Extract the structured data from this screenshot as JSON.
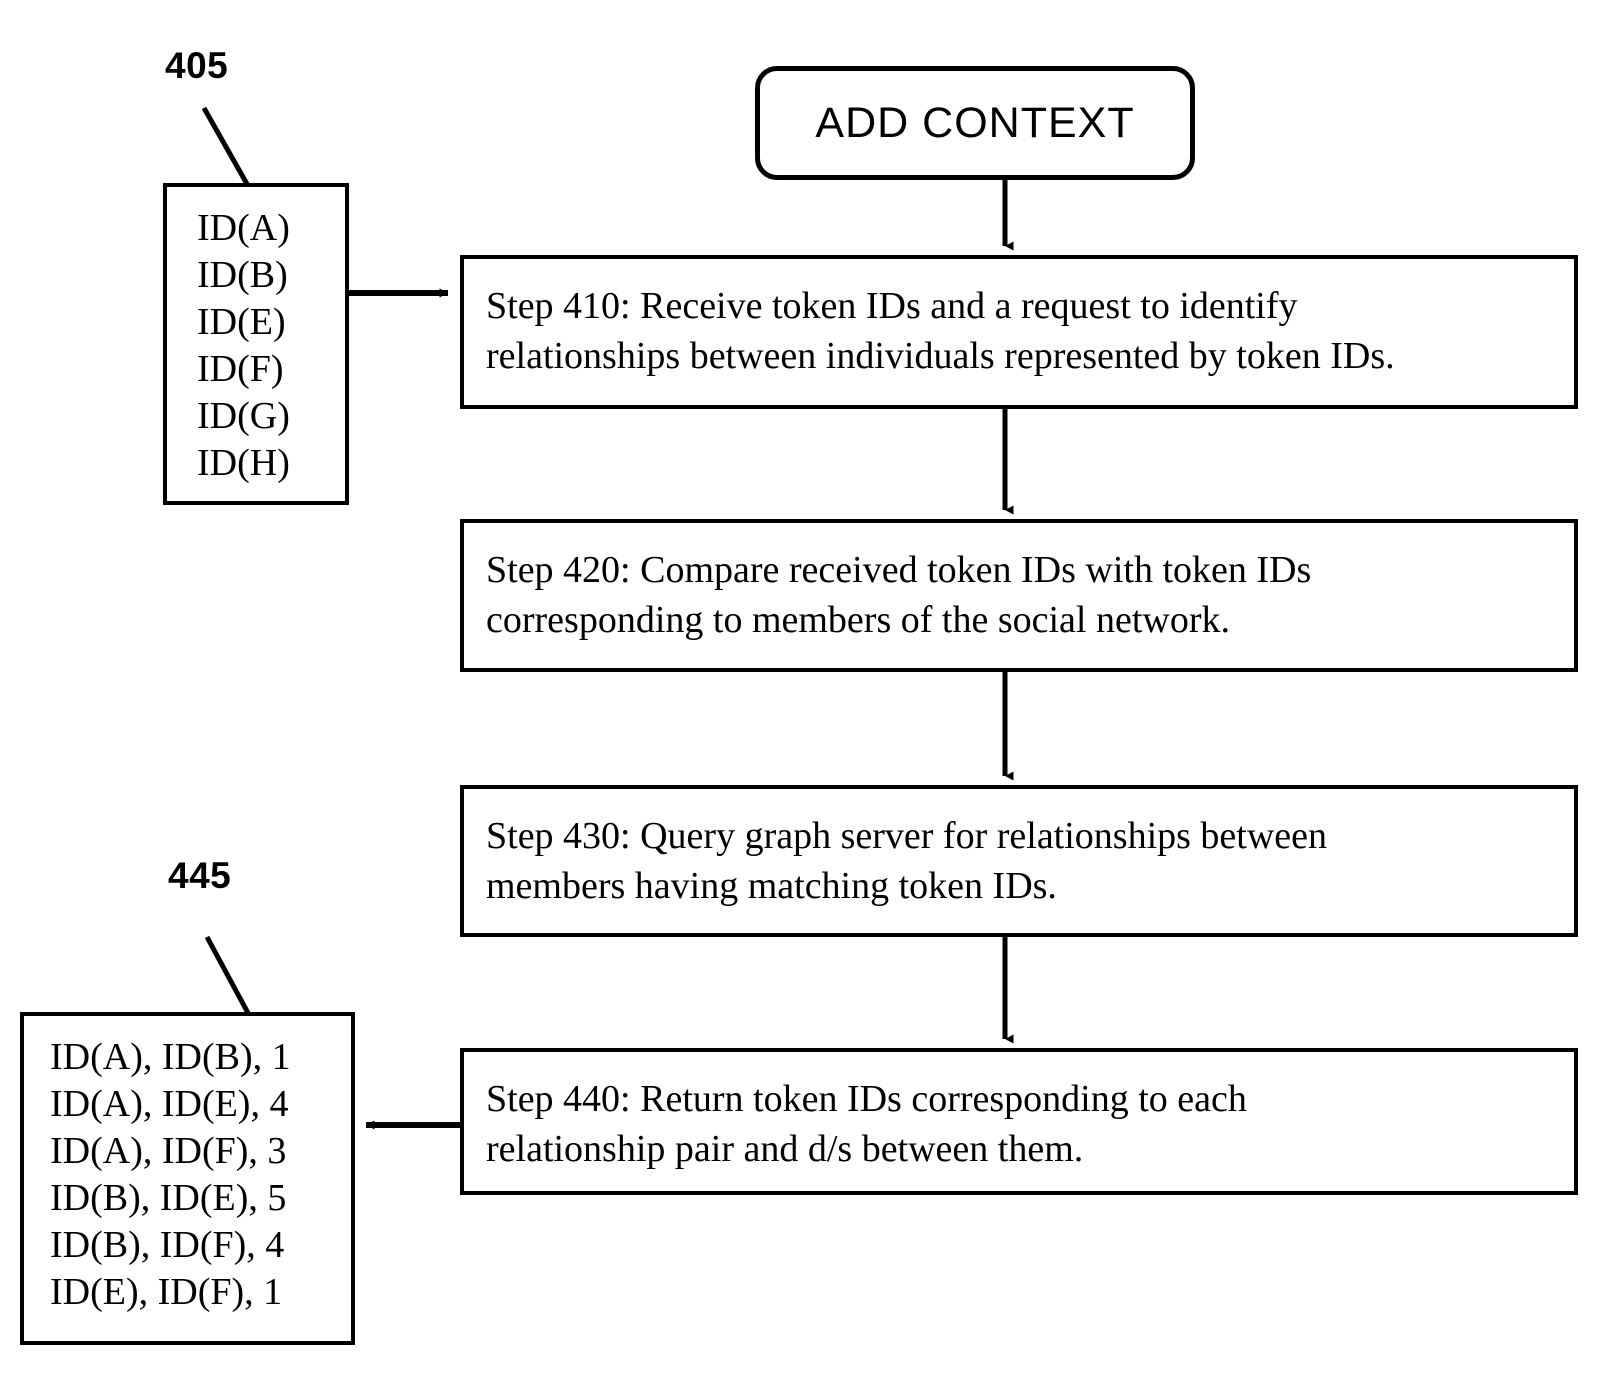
{
  "figure": {
    "type": "patent-flowchart",
    "background_color": "#ffffff",
    "line_color": "#000000"
  },
  "terminator": {
    "label": "ADD CONTEXT"
  },
  "reference_numerals": {
    "input_block": "405",
    "output_block": "445"
  },
  "input_block": {
    "name": "token-id-input-list",
    "items": [
      "ID(A)",
      "ID(B)",
      "ID(E)",
      "ID(F)",
      "ID(G)",
      "ID(H)"
    ]
  },
  "output_block": {
    "name": "relationship-pair-output-list",
    "items": [
      "ID(A), ID(B), 1",
      "ID(A), ID(E), 4",
      "ID(A), ID(F), 3",
      "ID(B), ID(E), 5",
      "ID(B), ID(F), 4",
      "ID(E), ID(F), 1"
    ]
  },
  "steps": [
    {
      "id": "410",
      "line1": "Step 410: Receive token IDs and a request to identify",
      "line2": "relationships between individuals represented by token IDs."
    },
    {
      "id": "420",
      "line1": "Step 420: Compare received token IDs with token IDs",
      "line2": "corresponding to members of the social network."
    },
    {
      "id": "430",
      "line1": "Step 430: Query graph server for relationships between",
      "line2": "members having matching token IDs."
    },
    {
      "id": "440",
      "line1": "Step 440: Return token IDs corresponding to each",
      "line2": "relationship pair and d/s between them."
    }
  ]
}
